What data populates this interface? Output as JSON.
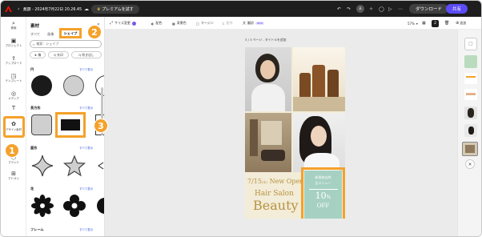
{
  "topbar": {
    "back": "‹",
    "doc_title": "無題 - 2024年7月22日 20.26.45",
    "premium": "プレミアムを試す",
    "download": "ダウンロード",
    "share": "共有"
  },
  "toolbar": {
    "resize": "サイズ変更",
    "color": "配色",
    "background": "背景色",
    "margin": "マージン",
    "reorder": "並列",
    "translate": "翻訳",
    "new_badge": "NEW",
    "zoom": "57%",
    "page_num": "2",
    "add": "追加"
  },
  "rail": [
    {
      "label": "検索",
      "glyph": "⌕"
    },
    {
      "label": "プロジェクト",
      "glyph": "▣"
    },
    {
      "label": "アップロード",
      "glyph": "⇪"
    },
    {
      "label": "テンプレート",
      "glyph": "◳"
    },
    {
      "label": "メディア",
      "glyph": "◎"
    },
    {
      "label": "",
      "glyph": "T"
    },
    {
      "label": "デザイン素材",
      "glyph": "✿"
    },
    {
      "label": "ブランド",
      "glyph": "⬡"
    },
    {
      "label": "アドオン",
      "glyph": "⊞"
    }
  ],
  "panel": {
    "title": "素材",
    "tabs": [
      "すべて",
      "画像",
      "シェイプ"
    ],
    "search_placeholder": "検索：シェイプ",
    "chips": [
      "★ 楕",
      "Q 矢印",
      "Q 吹き出し"
    ],
    "sections": [
      {
        "title": "円",
        "link": "すべて表示"
      },
      {
        "title": "長方形",
        "link": "すべて表示"
      },
      {
        "title": "星形",
        "link": "すべて表示"
      },
      {
        "title": "花",
        "link": "すべて表示"
      },
      {
        "title": "フレーム",
        "link": "すべて表示"
      }
    ]
  },
  "canvas": {
    "page_label": "3 / 3 ページ - タイトルを追加",
    "date_text": "7/15",
    "weekday": "(水)",
    "open_text": "New Open",
    "salon_text": "Hair Salon",
    "beauty_text": "Beauty",
    "promo_line1": "新規来店時",
    "promo_line2": "全メニュー",
    "promo_pct": "10",
    "promo_unit": "%",
    "promo_off": "OFF"
  },
  "annotations": [
    "1",
    "2",
    "3"
  ],
  "colors": {
    "accent_orange": "#f5a12a",
    "share_purple": "#5b4cf5",
    "promo_teal": "#a6d1c2",
    "cream": "#f2ecd8",
    "gold": "#b9923f"
  }
}
